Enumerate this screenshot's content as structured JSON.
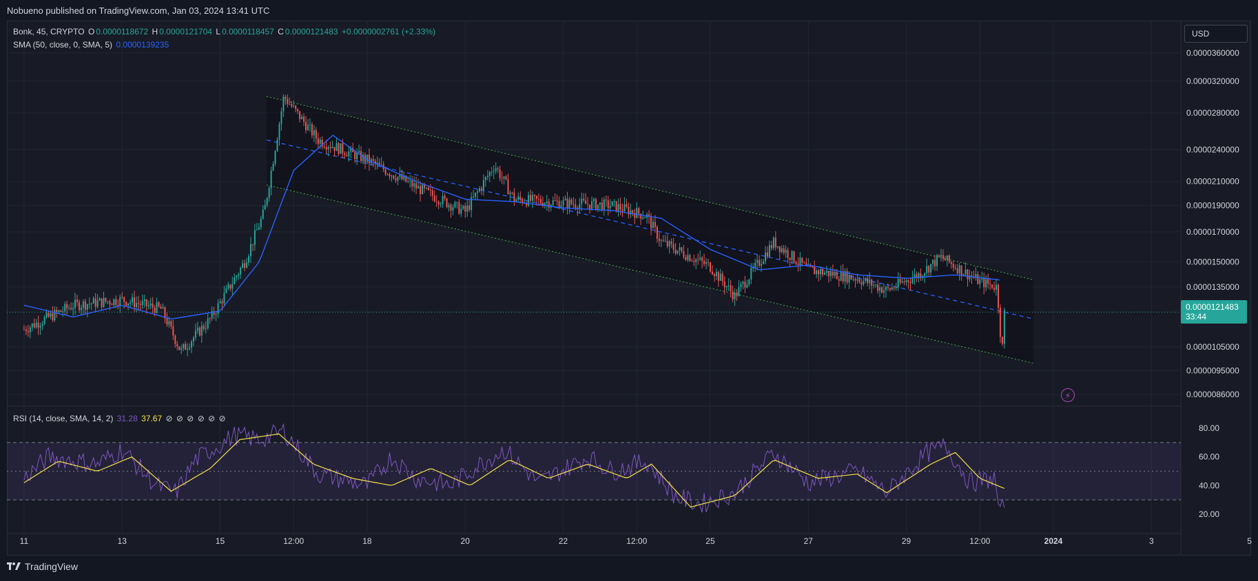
{
  "banner": "Nobueno published on TradingView.com, Jan 03, 2024 13:41 UTC",
  "currency": "USD",
  "legend": {
    "symbol": "Bonk, 45, CRYPTO",
    "o_label": "O",
    "o_value": "0.0000118672",
    "h_label": "H",
    "h_value": "0.0000121704",
    "l_label": "L",
    "l_value": "0.0000118457",
    "c_label": "C",
    "c_value": "0.0000121483",
    "change": "+0.0000002761 (+2.33%)",
    "sma_label": "SMA (50, close, 0, SMA, 5)",
    "sma_value": "0.0000139235",
    "rsi_label": "RSI (14, close, SMA, 14, 2)",
    "rsi_value": "31.28",
    "rsi_ma_value": "37.67",
    "rsi_icons": [
      "⊘",
      "⊘",
      "⊘",
      "⊘",
      "⊘",
      "⊘"
    ]
  },
  "price_tag": {
    "price": "0.0000121483",
    "countdown": "33:44"
  },
  "footer": {
    "brand": "TradingView"
  },
  "colors": {
    "up": "#26a69a",
    "down": "#ef5350",
    "sma": "#2962ff",
    "rsi": "#7e57c2",
    "rsi_ma": "#f7e34b",
    "channel": "#4caf50"
  },
  "chart_data": {
    "type": "candlestick",
    "symbol": "Bonk",
    "y_scale": "log",
    "y_ticks": [
      "0.0000360000",
      "0.0000320000",
      "0.0000280000",
      "0.0000240000",
      "0.0000210000",
      "0.0000190000",
      "0.0000170000",
      "0.0000150000",
      "0.0000135000",
      "0.0000105000",
      "0.0000095000",
      "0.0000086000"
    ],
    "x_ticks": [
      "11",
      "13",
      "15",
      "12:00",
      "18",
      "20",
      "22",
      "12:00",
      "25",
      "27",
      "29",
      "12:00",
      "2024",
      "3",
      "5"
    ],
    "price_anchors": [
      {
        "t": 0.0,
        "p": 1.13e-05
      },
      {
        "t": 1.0,
        "p": 1.25e-05
      },
      {
        "t": 2.0,
        "p": 1.28e-05
      },
      {
        "t": 2.8,
        "p": 1.23e-05
      },
      {
        "t": 3.2,
        "p": 1.03e-05
      },
      {
        "t": 3.8,
        "p": 1.18e-05
      },
      {
        "t": 4.5,
        "p": 1.5e-05
      },
      {
        "t": 4.9,
        "p": 1.85e-05
      },
      {
        "t": 5.3,
        "p": 3e-05
      },
      {
        "t": 6.0,
        "p": 2.5e-05
      },
      {
        "t": 7.0,
        "p": 2.3e-05
      },
      {
        "t": 8.0,
        "p": 2.05e-05
      },
      {
        "t": 9.0,
        "p": 1.85e-05
      },
      {
        "t": 9.6,
        "p": 2.25e-05
      },
      {
        "t": 10.0,
        "p": 1.95e-05
      },
      {
        "t": 11.0,
        "p": 1.92e-05
      },
      {
        "t": 12.0,
        "p": 1.9e-05
      },
      {
        "t": 12.7,
        "p": 1.82e-05
      },
      {
        "t": 13.0,
        "p": 1.63e-05
      },
      {
        "t": 14.0,
        "p": 1.47e-05
      },
      {
        "t": 14.5,
        "p": 1.3e-05
      },
      {
        "t": 15.3,
        "p": 1.63e-05
      },
      {
        "t": 16.0,
        "p": 1.45e-05
      },
      {
        "t": 17.0,
        "p": 1.4e-05
      },
      {
        "t": 17.6,
        "p": 1.33e-05
      },
      {
        "t": 18.3,
        "p": 1.43e-05
      },
      {
        "t": 18.7,
        "p": 1.53e-05
      },
      {
        "t": 19.5,
        "p": 1.38e-05
      },
      {
        "t": 19.85,
        "p": 1.35e-05
      },
      {
        "t": 19.95,
        "p": 1.02e-05
      },
      {
        "t": 20.0,
        "p": 1.21e-05
      }
    ],
    "sma_anchors": [
      {
        "t": 0.0,
        "p": 1.25e-05
      },
      {
        "t": 1.0,
        "p": 1.19e-05
      },
      {
        "t": 2.0,
        "p": 1.25e-05
      },
      {
        "t": 3.0,
        "p": 1.18e-05
      },
      {
        "t": 4.0,
        "p": 1.22e-05
      },
      {
        "t": 4.8,
        "p": 1.5e-05
      },
      {
        "t": 5.5,
        "p": 2.2e-05
      },
      {
        "t": 6.3,
        "p": 2.55e-05
      },
      {
        "t": 7.0,
        "p": 2.3e-05
      },
      {
        "t": 8.0,
        "p": 2.1e-05
      },
      {
        "t": 9.0,
        "p": 1.95e-05
      },
      {
        "t": 10.0,
        "p": 1.93e-05
      },
      {
        "t": 11.0,
        "p": 1.88e-05
      },
      {
        "t": 12.0,
        "p": 1.86e-05
      },
      {
        "t": 13.0,
        "p": 1.8e-05
      },
      {
        "t": 14.0,
        "p": 1.58e-05
      },
      {
        "t": 15.0,
        "p": 1.45e-05
      },
      {
        "t": 16.0,
        "p": 1.48e-05
      },
      {
        "t": 17.0,
        "p": 1.42e-05
      },
      {
        "t": 18.0,
        "p": 1.4e-05
      },
      {
        "t": 19.0,
        "p": 1.42e-05
      },
      {
        "t": 19.9,
        "p": 1.39e-05
      }
    ],
    "channel": {
      "upper": [
        {
          "t": 4.95,
          "p": 3e-05
        },
        {
          "t": 20.6,
          "p": 1.39e-05
        }
      ],
      "mid": [
        {
          "t": 4.95,
          "p": 2.5e-05
        },
        {
          "t": 20.6,
          "p": 1.18e-05
        }
      ],
      "lower": [
        {
          "t": 4.95,
          "p": 2.07e-05
        },
        {
          "t": 20.6,
          "p": 9.8e-06
        }
      ]
    },
    "current_price": 1.21483e-05,
    "rsi": {
      "levels": [
        70,
        50,
        30
      ],
      "y_ticks": [
        "80.00",
        "60.00",
        "40.00",
        "20.00"
      ],
      "rsi_anchors": [
        {
          "t": 0,
          "v": 45
        },
        {
          "t": 0.5,
          "v": 60
        },
        {
          "t": 1.5,
          "v": 55
        },
        {
          "t": 2.0,
          "v": 65
        },
        {
          "t": 2.7,
          "v": 40
        },
        {
          "t": 3.1,
          "v": 35
        },
        {
          "t": 3.5,
          "v": 58
        },
        {
          "t": 4.3,
          "v": 75
        },
        {
          "t": 4.8,
          "v": 72
        },
        {
          "t": 5.3,
          "v": 78
        },
        {
          "t": 6.0,
          "v": 48
        },
        {
          "t": 7.0,
          "v": 40
        },
        {
          "t": 7.5,
          "v": 60
        },
        {
          "t": 8.0,
          "v": 45
        },
        {
          "t": 8.7,
          "v": 40
        },
        {
          "t": 9.3,
          "v": 55
        },
        {
          "t": 9.8,
          "v": 65
        },
        {
          "t": 10.5,
          "v": 42
        },
        {
          "t": 11.5,
          "v": 60
        },
        {
          "t": 12.0,
          "v": 50
        },
        {
          "t": 12.7,
          "v": 57
        },
        {
          "t": 13.3,
          "v": 32
        },
        {
          "t": 13.8,
          "v": 27
        },
        {
          "t": 14.5,
          "v": 35
        },
        {
          "t": 15.3,
          "v": 63
        },
        {
          "t": 16.0,
          "v": 42
        },
        {
          "t": 17.0,
          "v": 50
        },
        {
          "t": 17.6,
          "v": 35
        },
        {
          "t": 18.4,
          "v": 62
        },
        {
          "t": 18.8,
          "v": 68
        },
        {
          "t": 19.3,
          "v": 42
        },
        {
          "t": 19.8,
          "v": 45
        },
        {
          "t": 19.92,
          "v": 18
        },
        {
          "t": 20.0,
          "v": 31
        }
      ],
      "ma_anchors": [
        {
          "t": 0,
          "v": 42
        },
        {
          "t": 0.7,
          "v": 57
        },
        {
          "t": 1.5,
          "v": 50
        },
        {
          "t": 2.2,
          "v": 60
        },
        {
          "t": 3.0,
          "v": 36
        },
        {
          "t": 3.8,
          "v": 52
        },
        {
          "t": 4.4,
          "v": 72
        },
        {
          "t": 5.2,
          "v": 76
        },
        {
          "t": 5.9,
          "v": 55
        },
        {
          "t": 6.7,
          "v": 45
        },
        {
          "t": 7.5,
          "v": 40
        },
        {
          "t": 8.3,
          "v": 52
        },
        {
          "t": 9.1,
          "v": 40
        },
        {
          "t": 9.9,
          "v": 58
        },
        {
          "t": 10.7,
          "v": 45
        },
        {
          "t": 11.5,
          "v": 55
        },
        {
          "t": 12.3,
          "v": 45
        },
        {
          "t": 12.8,
          "v": 55
        },
        {
          "t": 13.6,
          "v": 25
        },
        {
          "t": 14.5,
          "v": 33
        },
        {
          "t": 15.3,
          "v": 58
        },
        {
          "t": 16.2,
          "v": 45
        },
        {
          "t": 17.0,
          "v": 48
        },
        {
          "t": 17.6,
          "v": 35
        },
        {
          "t": 18.5,
          "v": 55
        },
        {
          "t": 19.0,
          "v": 63
        },
        {
          "t": 19.5,
          "v": 45
        },
        {
          "t": 20.0,
          "v": 38
        }
      ]
    }
  }
}
